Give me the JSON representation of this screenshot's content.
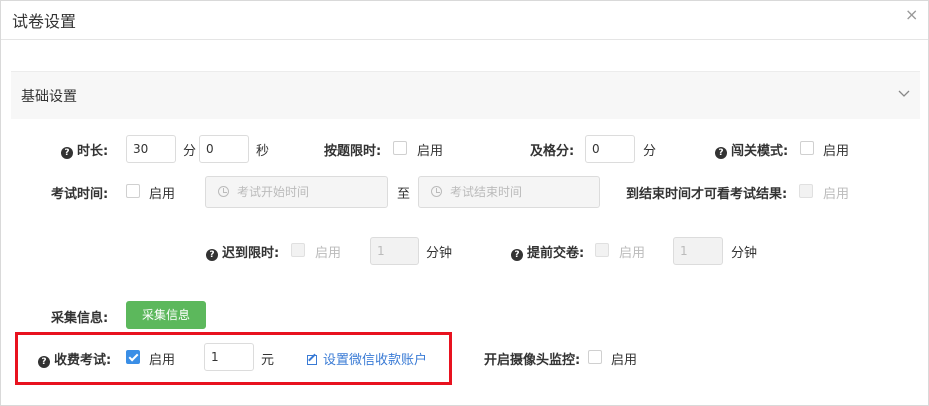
{
  "dialog": {
    "title": "试卷设置",
    "close_symbol": "×"
  },
  "section": {
    "title": "基础设置"
  },
  "row1": {
    "duration_label": "时长:",
    "hours_value": "30",
    "hours_unit": "分",
    "minutes_value": "0",
    "minutes_unit": "秒",
    "per_question_label": "按题限时:",
    "per_question_enable": "启用",
    "pass_label": "及格分:",
    "pass_value": "0",
    "pass_unit": "分",
    "level_label": "闯关模式:",
    "level_enable": "启用"
  },
  "row2": {
    "exam_time_label": "考试时间:",
    "exam_time_enable": "启用",
    "start_placeholder": "考试开始时间",
    "to_text": "至",
    "end_placeholder": "考试结束时间",
    "result_label": "到结束时间才可看考试结果:",
    "result_enable": "启用"
  },
  "row3": {
    "late_label": "迟到限时:",
    "late_enable": "启用",
    "late_value": "1",
    "late_unit": "分钟",
    "early_label": "提前交卷:",
    "early_enable": "启用",
    "early_value": "1",
    "early_unit": "分钟"
  },
  "row4": {
    "collect_label": "采集信息:",
    "collect_button": "采集信息"
  },
  "row5": {
    "fee_label": "收费考试:",
    "fee_enable": "启用",
    "fee_checked": true,
    "fee_value": "1",
    "fee_unit": "元",
    "wechat_link": "设置微信收款账户",
    "camera_label": "开启摄像头监控:",
    "camera_enable": "启用"
  },
  "colors": {
    "accent": "#3a8ee6",
    "green": "#5cb85c",
    "highlight": "#e8121f",
    "link": "#3a7bd5"
  }
}
